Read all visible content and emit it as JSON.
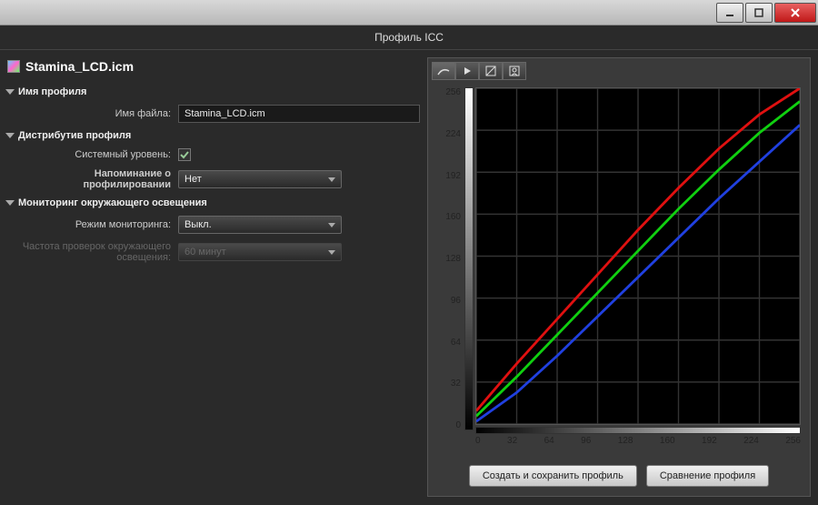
{
  "window": {
    "subtitle": "Профиль ICC"
  },
  "file": {
    "name": "Stamina_LCD.icm"
  },
  "sections": {
    "profile_name": "Имя профиля",
    "distribution": "Дистрибутив профиля",
    "monitoring": "Мониторинг окружающего освещения"
  },
  "labels": {
    "filename": "Имя файла:",
    "system_level": "Системный уровень:",
    "reminder": "Напоминание о профилировании",
    "mode": "Режим мониторинга:",
    "freq": "Частота проверок окружающего освещения:"
  },
  "values": {
    "filename": "Stamina_LCD.icm",
    "system_level_checked": true,
    "reminder": "Нет",
    "mode": "Выкл.",
    "freq": "60 минут"
  },
  "buttons": {
    "save": "Создать и сохранить профиль",
    "compare": "Сравнение профиля"
  },
  "chart_data": {
    "type": "line",
    "xlabel": "",
    "ylabel": "",
    "xlim": [
      0,
      256
    ],
    "ylim": [
      0,
      256
    ],
    "xticks": [
      0,
      32,
      64,
      96,
      128,
      160,
      192,
      224,
      256
    ],
    "yticks": [
      0,
      32,
      64,
      96,
      128,
      160,
      192,
      224,
      256
    ],
    "series": [
      {
        "name": "R",
        "color": "#e01010",
        "x": [
          0,
          32,
          64,
          96,
          128,
          160,
          192,
          224,
          256
        ],
        "y": [
          10,
          46,
          80,
          114,
          148,
          180,
          210,
          236,
          256
        ]
      },
      {
        "name": "G",
        "color": "#10d010",
        "x": [
          0,
          32,
          64,
          96,
          128,
          160,
          192,
          224,
          256
        ],
        "y": [
          6,
          36,
          68,
          100,
          132,
          164,
          194,
          222,
          246
        ]
      },
      {
        "name": "B",
        "color": "#2040e0",
        "x": [
          0,
          32,
          64,
          96,
          128,
          160,
          192,
          224,
          256
        ],
        "y": [
          2,
          24,
          52,
          82,
          112,
          142,
          172,
          200,
          228
        ]
      }
    ]
  }
}
